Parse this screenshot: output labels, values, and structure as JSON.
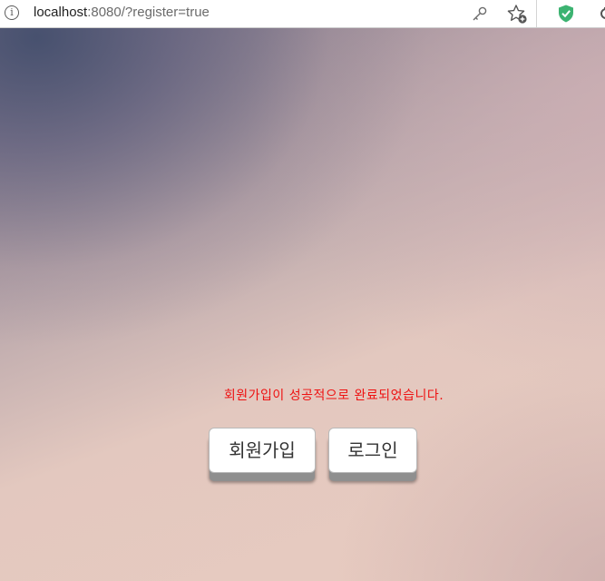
{
  "browser": {
    "url_host": "localhost",
    "url_rest": ":8080/?register=true",
    "info_icon_glyph": "i",
    "icons": [
      "info-icon",
      "key-icon",
      "add-favorite-icon",
      "shield-extension-icon"
    ],
    "shield_color": "#3cb371"
  },
  "main": {
    "message": "회원가입이 성공적으로 완료되었습니다.",
    "message_color": "#ee1111",
    "register_button_label": "회원가입",
    "login_button_label": "로그인"
  }
}
